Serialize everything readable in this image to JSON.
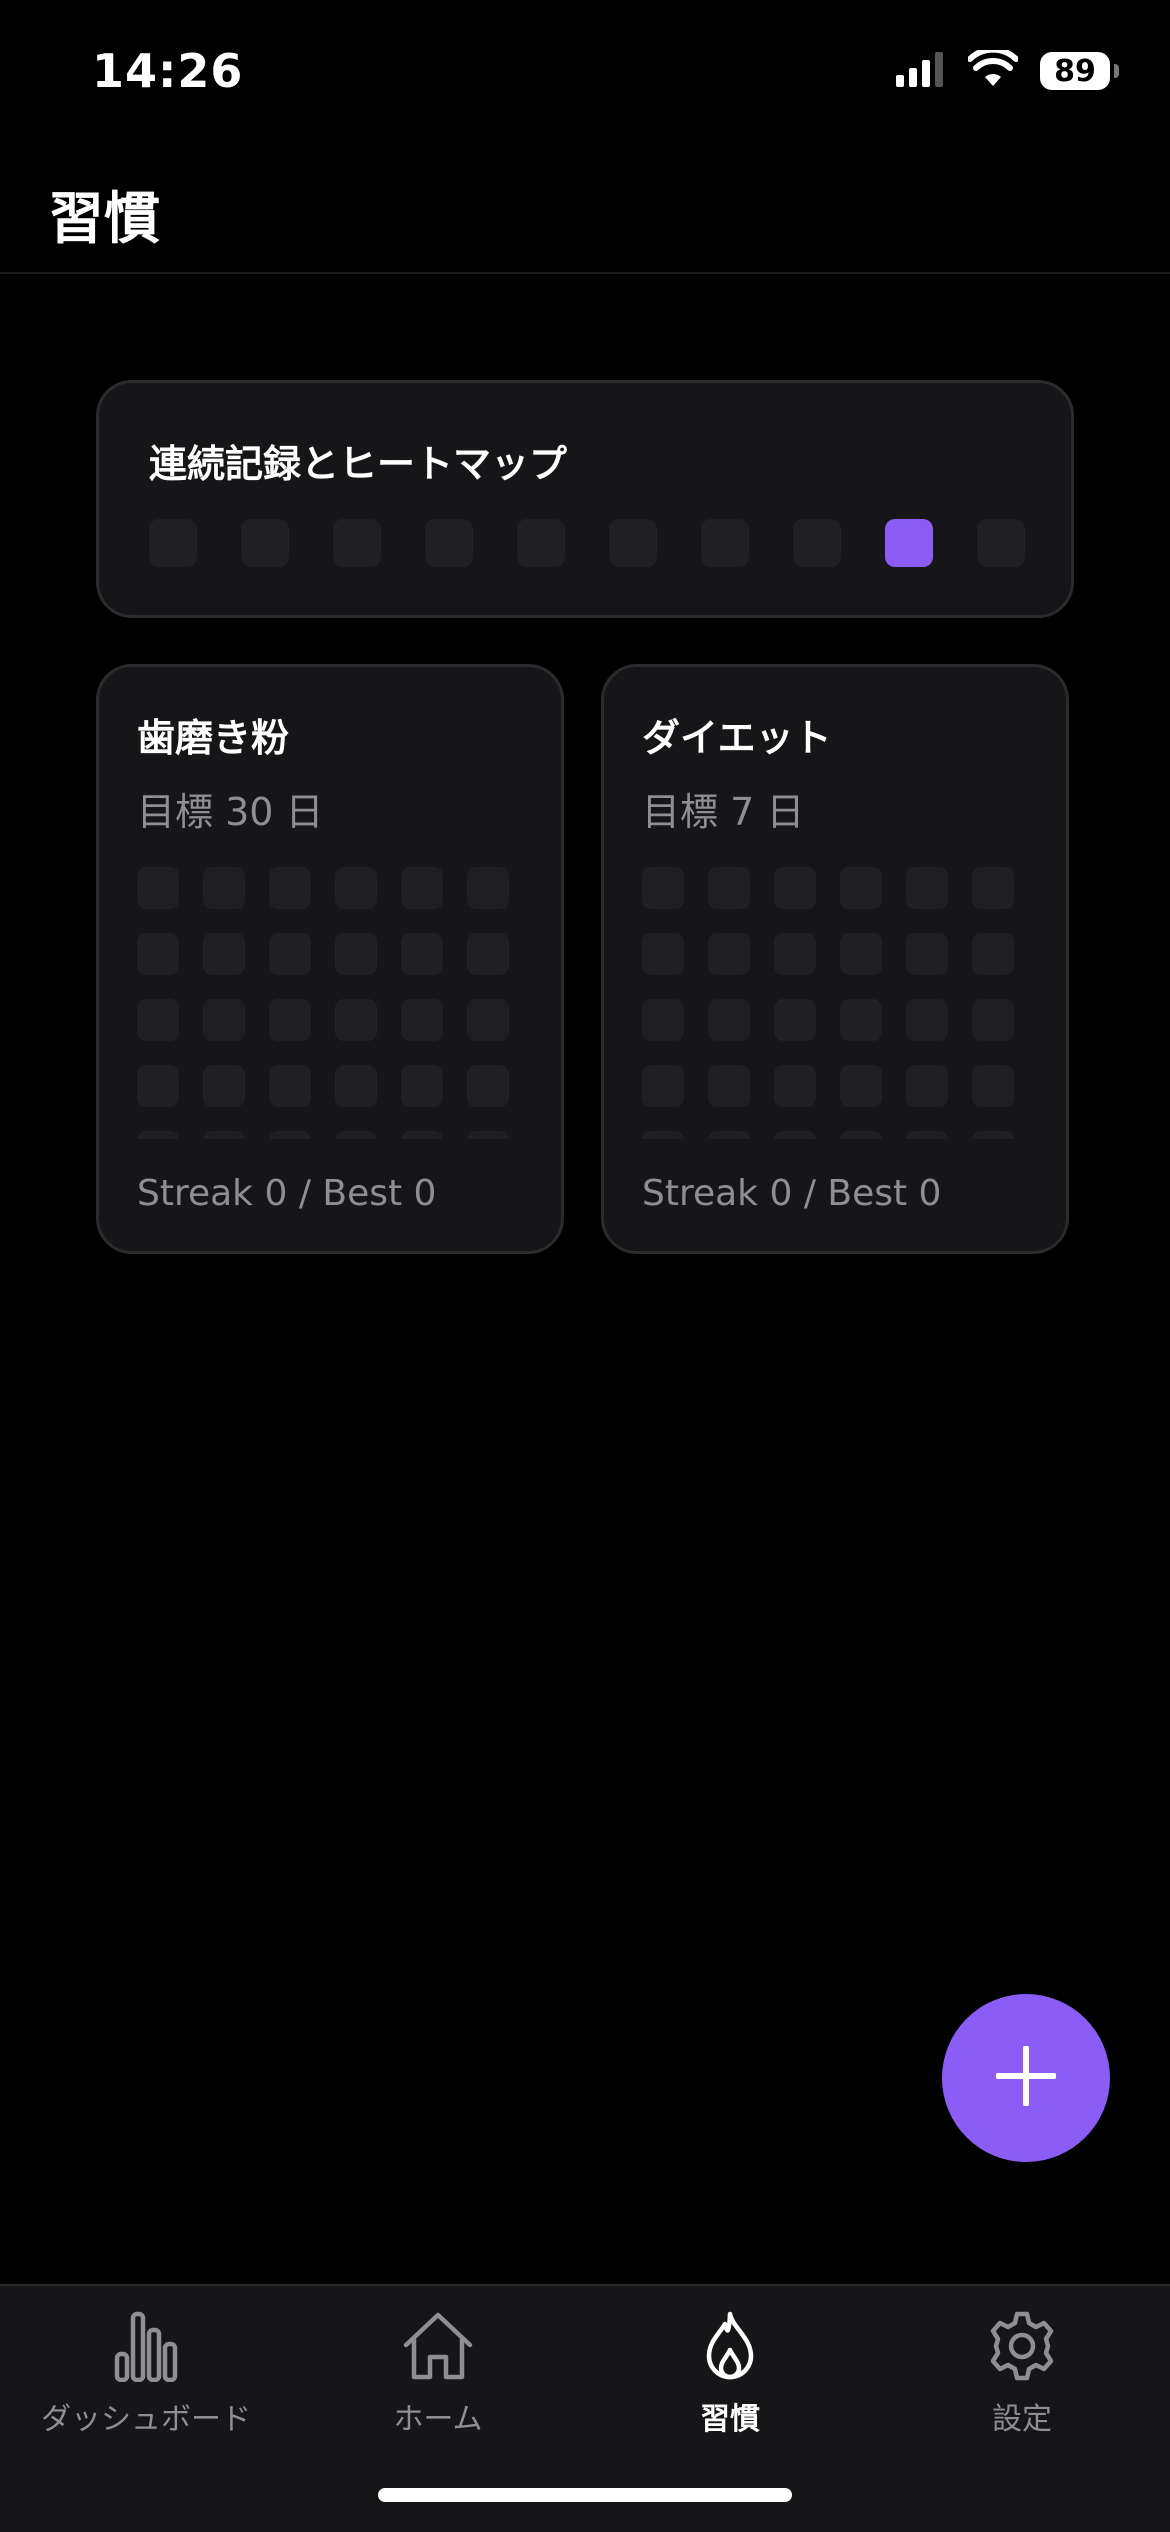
{
  "status_bar": {
    "time": "14:26",
    "battery": "89"
  },
  "header": {
    "title": "習慣"
  },
  "summary": {
    "title": "連続記録とヒートマップ",
    "cells": [
      false,
      false,
      false,
      false,
      false,
      false,
      false,
      false,
      true,
      false
    ]
  },
  "habits": [
    {
      "name": "歯磨き粉",
      "goal": "目標 30 日",
      "streak": "Streak 0 / Best 0"
    },
    {
      "name": "ダイエット",
      "goal": "目標 7 日",
      "streak": "Streak 0 / Best 0"
    }
  ],
  "fab": {
    "icon": "plus-icon"
  },
  "tab_bar": {
    "tabs": [
      {
        "label": "ダッシュボード",
        "icon": "bar-chart-icon",
        "active": false
      },
      {
        "label": "ホーム",
        "icon": "home-icon",
        "active": false
      },
      {
        "label": "習慣",
        "icon": "flame-icon",
        "active": true
      },
      {
        "label": "設定",
        "icon": "gear-icon",
        "active": false
      }
    ]
  },
  "colors": {
    "accent": "#8b5cf6",
    "card": "#161618",
    "cell": "#202022",
    "muted_text": "#8e8e93"
  }
}
